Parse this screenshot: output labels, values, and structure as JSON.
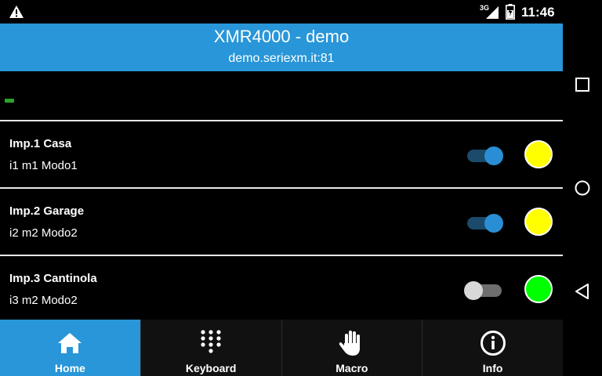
{
  "status_bar": {
    "network_type": "3G",
    "time": "11:46",
    "icons": [
      "warning-icon",
      "signal-icon",
      "battery-icon"
    ]
  },
  "header": {
    "title": "XMR4000 - demo",
    "subtitle": "demo.seriexm.it:81"
  },
  "rows": [
    {
      "title": "Imp.1 Casa",
      "subtitle": "i1 m1 Modo1",
      "toggle_on": true,
      "lamp_color": "#ffff00"
    },
    {
      "title": "Imp.2 Garage",
      "subtitle": "i2 m2 Modo2",
      "toggle_on": true,
      "lamp_color": "#ffff00"
    },
    {
      "title": "Imp.3 Cantinola",
      "subtitle": "i3 m2 Modo2",
      "toggle_on": false,
      "lamp_color": "#00ff00"
    }
  ],
  "bottom_nav": [
    {
      "label": "Home",
      "icon": "home-icon",
      "active": true
    },
    {
      "label": "Keyboard",
      "icon": "keypad-icon",
      "active": false
    },
    {
      "label": "Macro",
      "icon": "hand-icon",
      "active": false
    },
    {
      "label": "Info",
      "icon": "info-icon",
      "active": false
    }
  ],
  "colors": {
    "accent": "#2896d8",
    "status_led": "#2aa52a"
  }
}
